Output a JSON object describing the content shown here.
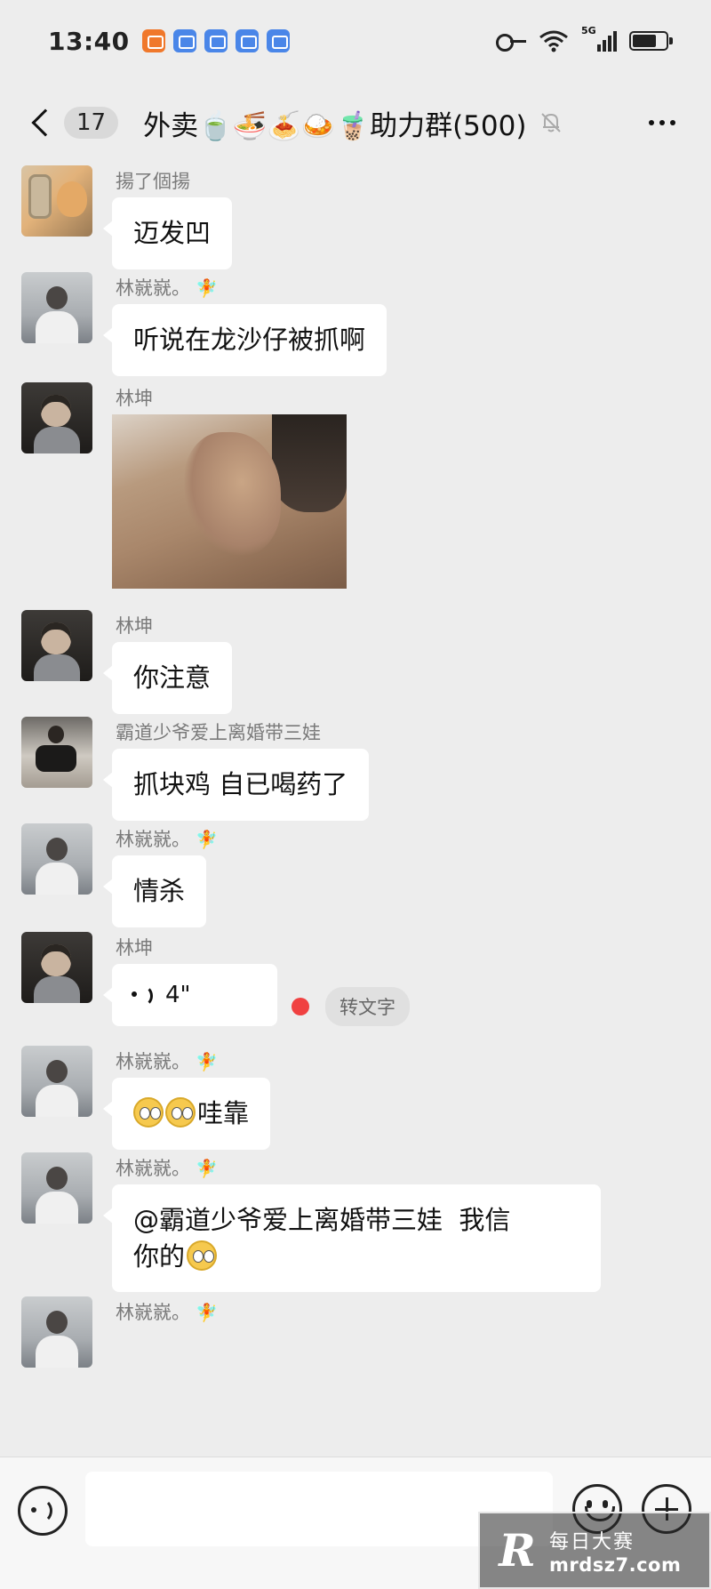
{
  "status_bar": {
    "time": "13:40",
    "network_label": "5G",
    "icons": [
      "app-icon-orange",
      "app-icon-blue",
      "app-icon-blue",
      "app-icon-blue",
      "app-icon-mail",
      "key-icon",
      "wifi-icon",
      "signal-icon",
      "battery-icon"
    ]
  },
  "header": {
    "unread_count": "17",
    "title": "外卖🍵🍜🍝🍛🧋助力群(500)",
    "icons": [
      "back-chevron-icon",
      "mute-bell-icon",
      "more-dots-icon"
    ]
  },
  "messages": [
    {
      "sender": "揚了個揚",
      "text": "迈发凹",
      "avatar": "cat-phone-photo"
    },
    {
      "sender": "林㠇㠇。",
      "badge": "fairy-icon",
      "text": "听说在龙沙仔被抓啊",
      "avatar": "man-posing"
    },
    {
      "sender": "林坤",
      "type": "image",
      "avatar": "man-sunglasses"
    },
    {
      "sender": "林坤",
      "text": "你注意",
      "avatar": "man-sunglasses"
    },
    {
      "sender": "霸道少爷爱上离婚带三娃",
      "text": "抓块鸡 自已喝药了",
      "avatar": "man-sitting"
    },
    {
      "sender": "林㠇㠇。",
      "badge": "fairy-icon",
      "text": "情杀",
      "avatar": "man-posing"
    },
    {
      "sender": "林坤",
      "type": "voice",
      "duration": "4\"",
      "to_text": "转文字",
      "avatar": "man-sunglasses"
    },
    {
      "sender": "林㠇㠇。",
      "badge": "fairy-icon",
      "text": "哇靠",
      "emoji_count": 2,
      "avatar": "man-posing"
    },
    {
      "sender": "林㠇㠇。",
      "badge": "fairy-icon",
      "text_line1": "@霸道少爷爱上离婚带三娃  我信",
      "text_line2": "你的",
      "avatar": "man-posing"
    },
    {
      "sender": "林㠇㠇。",
      "badge": "fairy-icon",
      "avatar": "man-posing"
    }
  ],
  "input_bar": {
    "placeholder": "",
    "icons": [
      "voice-input-icon",
      "emoji-icon",
      "plus-icon"
    ]
  },
  "watermark": {
    "logo": "R",
    "cn": "每日大赛",
    "url": "mrdsz7.com"
  }
}
